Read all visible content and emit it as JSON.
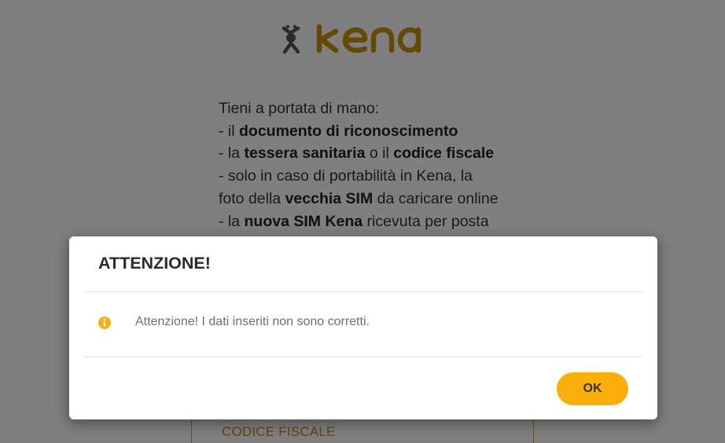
{
  "logo": {
    "text": "kena",
    "brand_color": "#c8930e",
    "mascot_color": "#555555"
  },
  "instructions": {
    "intro": "Tieni a portata di mano:",
    "items": [
      {
        "prefix": "-  il ",
        "bold": "documento di riconoscimento",
        "suffix": ""
      },
      {
        "prefix": "-  la ",
        "bold": "tessera sanitaria",
        "middle": " o il ",
        "bold2": "codice fiscale"
      },
      {
        "prefix": "-  solo in caso di portabilità in Kena, la",
        "bold": "",
        "suffix": ""
      },
      {
        "prefix": "foto della ",
        "bold": "vecchia SIM",
        "suffix": " da caricare online"
      },
      {
        "prefix": "-  la ",
        "bold": "nuova SIM Kena",
        "suffix": " ricevuta per posta"
      }
    ]
  },
  "cf_button": {
    "label": "CODICE FISCALE"
  },
  "modal": {
    "title": "ATTENZIONE!",
    "icon": "info-icon",
    "message": "Attenzione! I dati inseriti non sono corretti.",
    "ok_label": "OK",
    "accent_color": "#f9ae0a"
  }
}
